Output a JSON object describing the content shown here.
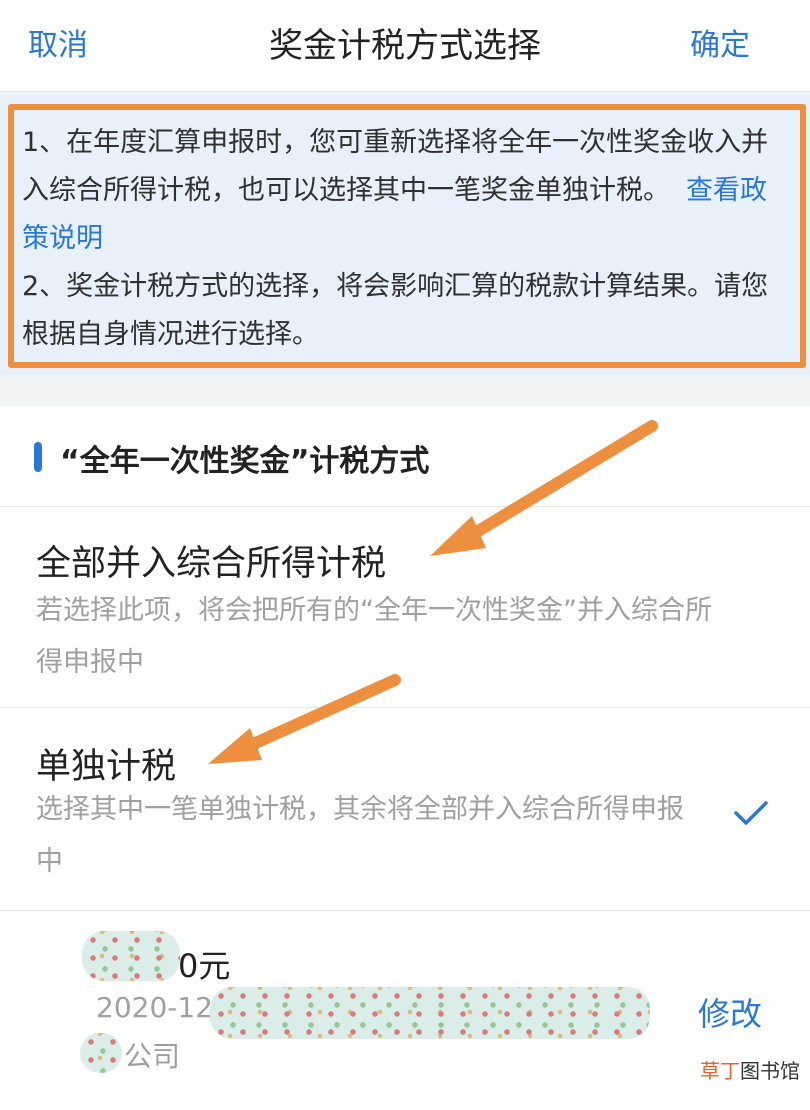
{
  "header": {
    "cancel_label": "取消",
    "title": "奖金计税方式选择",
    "confirm_label": "确定"
  },
  "notice": {
    "line1": "1、在年度汇算申报时，您可重新选择将全年一次性奖金收入并入综合所得计税，也可以选择其中一笔奖金单独计税。",
    "link": "查看政策说明",
    "line2": "2、奖金计税方式的选择，将会影响汇算的税款计算结果。请您根据自身情况进行选择。",
    "frame_color": "#ee8e3f"
  },
  "section": {
    "title": "“全年一次性奖金”计税方式"
  },
  "options": [
    {
      "title": "全部并入综合所得计税",
      "description": "若选择此项，将会把所有的“全年一次性奖金”并入综合所得申报中",
      "selected": false
    },
    {
      "title": "单独计税",
      "description": "选择其中一笔单独计税，其余将全部并入综合所得申报中",
      "selected": true,
      "icon": "check-icon"
    }
  ],
  "record": {
    "amount_suffix": "0元",
    "date_prefix": "2020-12",
    "company_suffix": "公司",
    "edit_label": "修改"
  },
  "watermark": {
    "accent": "草丁",
    "rest": "图书馆"
  },
  "colors": {
    "accent_blue": "#2a78d6",
    "annotation_orange": "#ee8e3f"
  }
}
